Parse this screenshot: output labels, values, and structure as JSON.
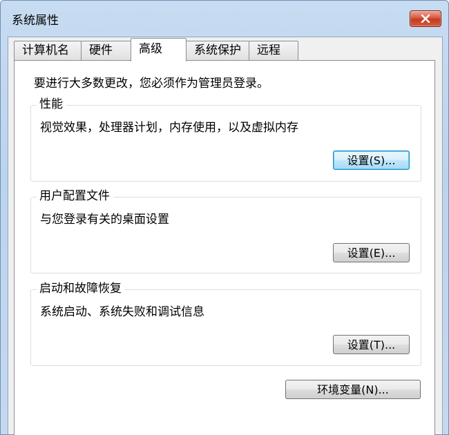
{
  "window": {
    "title": "系统属性"
  },
  "tabs": [
    {
      "label": "计算机名",
      "active": false
    },
    {
      "label": "硬件",
      "active": false
    },
    {
      "label": "高级",
      "active": true
    },
    {
      "label": "系统保护",
      "active": false
    },
    {
      "label": "远程",
      "active": false
    }
  ],
  "advanced": {
    "admin_note": "要进行大多数更改，您必须作为管理员登录。",
    "performance": {
      "title": "性能",
      "description": "视觉效果，处理器计划，内存使用，以及虚拟内存",
      "button": "设置(S)..."
    },
    "user_profiles": {
      "title": "用户配置文件",
      "description": "与您登录有关的桌面设置",
      "button": "设置(E)..."
    },
    "startup_recovery": {
      "title": "启动和故障恢复",
      "description": "系统启动、系统失败和调试信息",
      "button": "设置(T)..."
    },
    "env_button": "环境变量(N)..."
  },
  "icons": {
    "close": "close-icon"
  },
  "colors": {
    "titlebar": "#bcd3ec",
    "close_button": "#c23b22",
    "focus_border": "#3c7fb1"
  }
}
